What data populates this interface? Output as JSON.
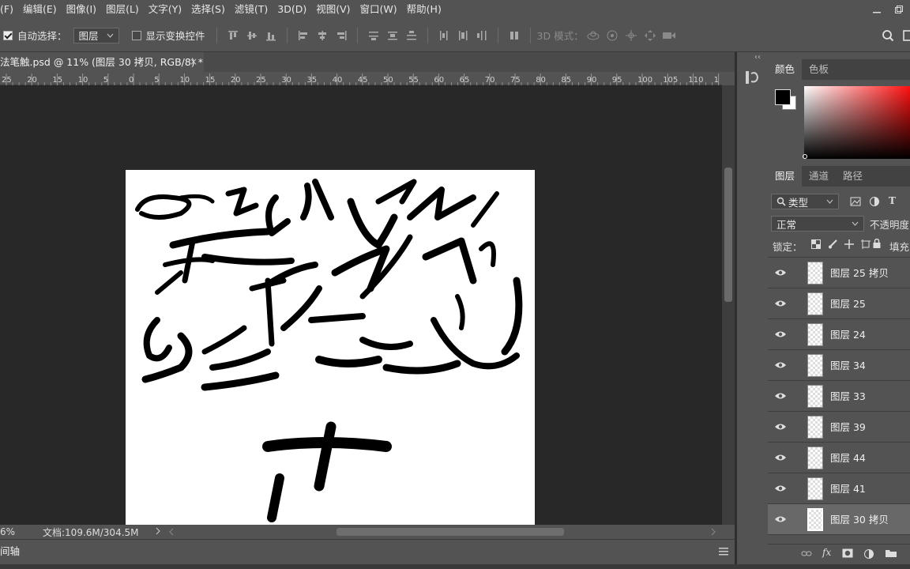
{
  "menubar": {
    "items": [
      "(F)",
      "编辑(E)",
      "图像(I)",
      "图层(L)",
      "文字(Y)",
      "选择(S)",
      "滤镜(T)",
      "3D(D)",
      "视图(V)",
      "窗口(W)",
      "帮助(H)"
    ]
  },
  "options": {
    "auto_select_label": "自动选择：",
    "auto_select_checked": true,
    "auto_select_value": "图层",
    "show_transform_label": "显示变换控件",
    "mode_3d_label": "3D 模式："
  },
  "document": {
    "tab_title": "法笔触.psd @ 11% (图层 30 拷贝, RGB/8) *",
    "close_glyph": "×"
  },
  "ruler": {
    "ticks": [
      "25",
      "20",
      "15",
      "10",
      "5",
      "0",
      "5",
      "10",
      "15",
      "20",
      "25",
      "30",
      "35",
      "40",
      "45",
      "50",
      "55",
      "60",
      "65",
      "70",
      "75",
      "80",
      "85",
      "90",
      "95",
      "100",
      "105",
      "110",
      "1"
    ]
  },
  "status": {
    "zoom": "6%",
    "doc_info": "文档:109.6M/304.5M"
  },
  "timeline": {
    "label": "间轴"
  },
  "color_panel": {
    "tabs": [
      "颜色",
      "色板"
    ],
    "active_tab": "颜色",
    "fg_color": "#000000",
    "bg_color": "#ffffff"
  },
  "layers_panel": {
    "tabs": [
      "图层",
      "通道",
      "路径"
    ],
    "active_tab": "图层",
    "filter_label": "类型",
    "blend_mode": "正常",
    "opacity_label": "不透明度",
    "lock_label": "锁定：",
    "fill_label": "填充",
    "layers": [
      {
        "name": "图层 25 拷贝",
        "selected": false
      },
      {
        "name": "图层 25",
        "selected": false
      },
      {
        "name": "图层 24",
        "selected": false
      },
      {
        "name": "图层 34",
        "selected": false
      },
      {
        "name": "图层 33",
        "selected": false
      },
      {
        "name": "图层 39",
        "selected": false
      },
      {
        "name": "图层 44",
        "selected": false
      },
      {
        "name": "图层 41",
        "selected": false
      },
      {
        "name": "图层 30 拷贝",
        "selected": true
      }
    ]
  }
}
